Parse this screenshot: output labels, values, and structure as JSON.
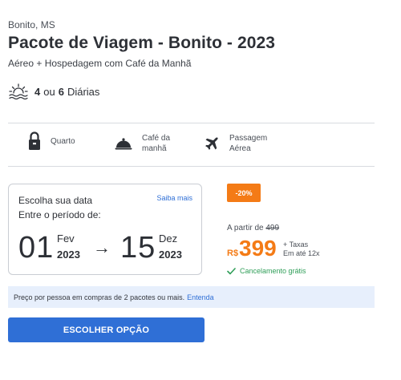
{
  "header": {
    "location": "Bonito, MS",
    "title": "Pacote de Viagem - Bonito - 2023",
    "subtitle": "Aéreo + Hospedagem com Café da Manhã"
  },
  "stay": {
    "icon": "sunset-icon",
    "option_a": "4",
    "separator": "ou",
    "option_b": "6",
    "unit": "Diárias"
  },
  "amenities": [
    {
      "icon": "lock-icon",
      "label_1": "Quarto",
      "label_2": ""
    },
    {
      "icon": "cloche-icon",
      "label_1": "Café da",
      "label_2": "manhã"
    },
    {
      "icon": "airplane-icon",
      "label_1": "Passagem",
      "label_2": "Aérea"
    }
  ],
  "date_card": {
    "title": "Escolha sua data",
    "more_link": "Saiba mais",
    "period_label": "Entre o período de:",
    "start": {
      "day": "01",
      "month": "Fev",
      "year": "2023"
    },
    "arrow": "→",
    "end": {
      "day": "15",
      "month": "Dez",
      "year": "2023"
    }
  },
  "pricing": {
    "discount_badge": "-20%",
    "from_label": "A partir de",
    "old_price": "499",
    "currency": "R$",
    "price": "399",
    "taxes_line_1": "+ Taxas",
    "taxes_line_2": "Em até 12x",
    "cancellation": "Cancelamento grátis"
  },
  "info_bar": {
    "text": "Preço por pessoa em compras de 2 pacotes ou mais.",
    "link": "Entenda"
  },
  "cta": {
    "label": "ESCOLHER OPÇÃO"
  },
  "colors": {
    "accent_blue": "#2f6fd6",
    "accent_orange": "#f47b16",
    "success_green": "#2f9e58",
    "info_bg": "#e7effc"
  }
}
